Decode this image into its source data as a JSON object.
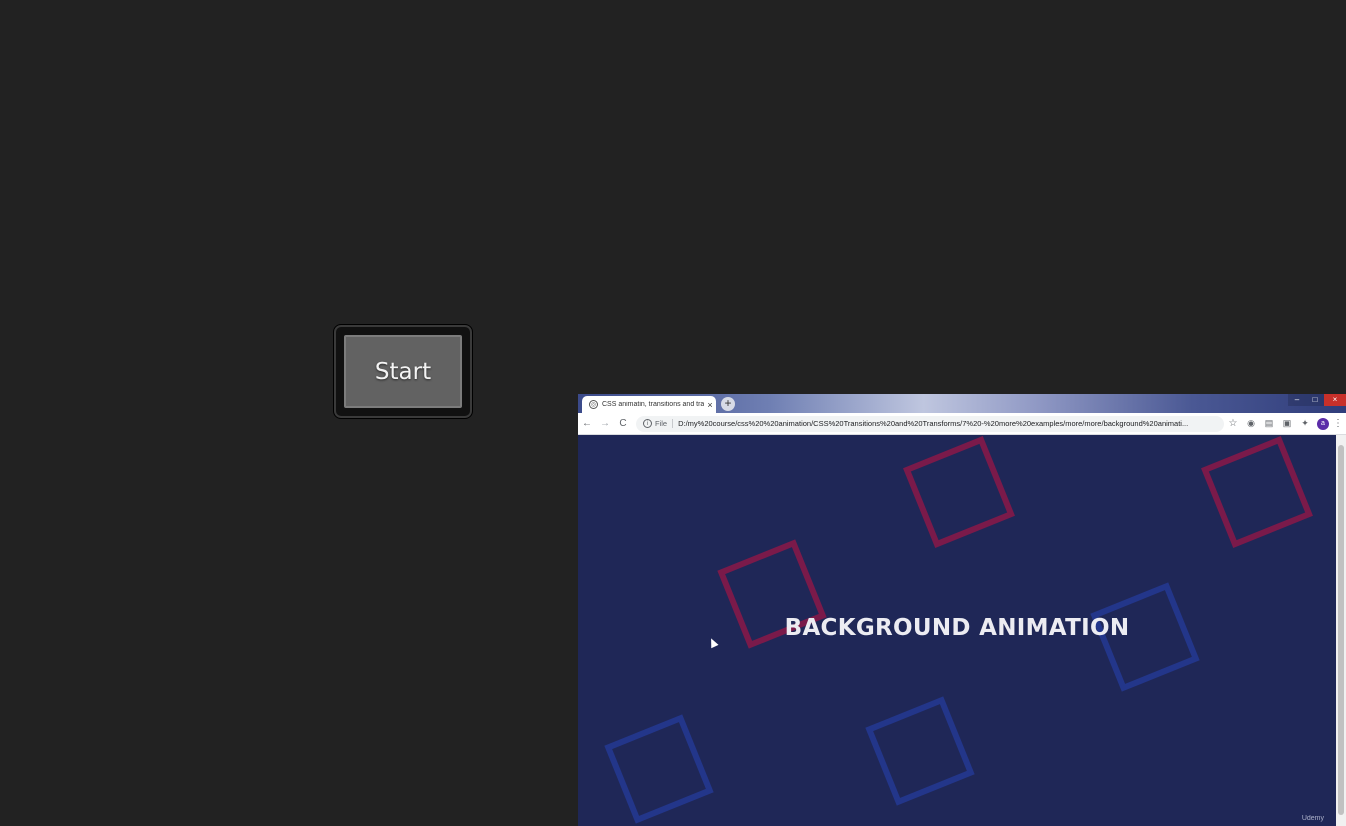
{
  "start_button": {
    "label": "Start"
  },
  "browser": {
    "tab_title": "CSS animatin, transitions and tra",
    "tab_close": "×",
    "new_tab": "+",
    "window_controls": [
      "–",
      "□",
      "×"
    ],
    "back": "←",
    "forward": "→",
    "reload": "C",
    "info": "i",
    "file_label": "File",
    "url": "D:/my%20course/css%20%20animation/CSS%20Transitions%20and%20Transforms/7%20-%20more%20examples/more/more/background%20animati...",
    "bookmark": "☆",
    "extensions": [
      "◉",
      "▤",
      "▣",
      "✦"
    ],
    "avatar_initial": "a",
    "menu": "⋮",
    "page_heading": "BACKGROUND ANIMATION",
    "watermark": "Udemy"
  },
  "colors": {
    "page_bg": "#222222",
    "viewport_bg": "#1f2757",
    "square_red": "#7a1a4a",
    "square_blue": "#23368a"
  }
}
